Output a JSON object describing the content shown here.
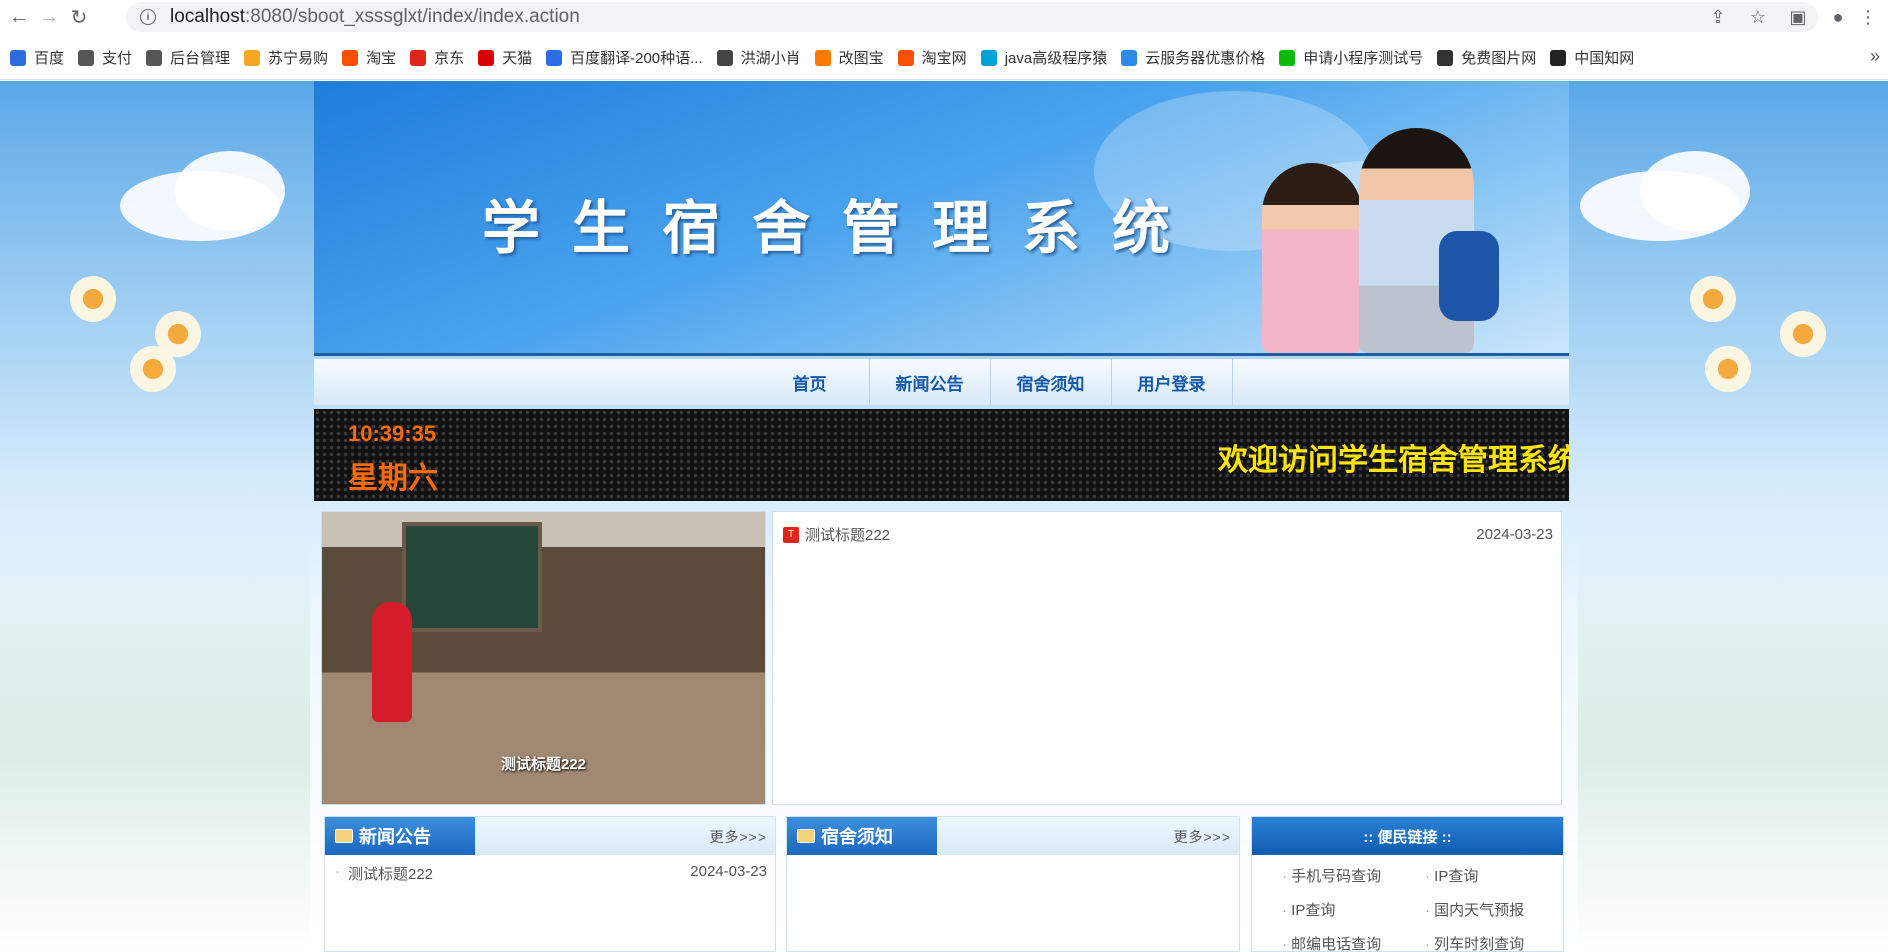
{
  "browser": {
    "url_host": "localhost",
    "url_rest": ":8080/sboot_xsssglxt/index/index.action",
    "bookmarks": [
      {
        "label": "百度",
        "color": "#2d6cdf"
      },
      {
        "label": "支付",
        "color": "#555555"
      },
      {
        "label": "后台管理",
        "color": "#555555"
      },
      {
        "label": "苏宁易购",
        "color": "#f5a623"
      },
      {
        "label": "淘宝",
        "color": "#ff5000"
      },
      {
        "label": "京东",
        "color": "#e1251b"
      },
      {
        "label": "天猫",
        "color": "#d90000"
      },
      {
        "label": "百度翻译-200种语...",
        "color": "#2b6de5"
      },
      {
        "label": "洪湖小肖",
        "color": "#444444"
      },
      {
        "label": "改图宝",
        "color": "#ff7a00"
      },
      {
        "label": "淘宝网",
        "color": "#ff5000"
      },
      {
        "label": "java高级程序猿",
        "color": "#00a1d6"
      },
      {
        "label": "云服务器优惠价格",
        "color": "#2e8ae6"
      },
      {
        "label": "申请小程序测试号",
        "color": "#09bb07"
      },
      {
        "label": "免费图片网",
        "color": "#333333"
      },
      {
        "label": "中国知网",
        "color": "#222222"
      }
    ],
    "bookmarks_more": "»"
  },
  "site": {
    "banner_title": "学生宿舍管理系统",
    "nav": [
      {
        "label": "首页"
      },
      {
        "label": "新闻公告"
      },
      {
        "label": "宿舍须知"
      },
      {
        "label": "用户登录"
      }
    ],
    "clock_time": "10:39:35",
    "clock_day": "星期六",
    "marquee_text": "欢迎访问学生宿舍管理系统"
  },
  "slider": {
    "caption": "测试标题222"
  },
  "news_list": [
    {
      "badge": "T",
      "title": "测试标题222",
      "date": "2024-03-23"
    }
  ],
  "panels": {
    "news": {
      "title": "新闻公告",
      "more": "更多>>>",
      "items": [
        {
          "title": "测试标题222",
          "date": "2024-03-23"
        }
      ]
    },
    "dorm": {
      "title": "宿舍须知",
      "more": "更多>>>"
    },
    "links": {
      "title": ":: 便民链接 ::",
      "items": [
        "手机号码查询",
        "IP查询",
        "IP查询",
        "国内天气预报",
        "邮编电话查询",
        "列车时刻查询"
      ]
    }
  },
  "icons": {
    "back": "←",
    "forward": "→",
    "reload": "↻",
    "share": "⇪",
    "star": "☆",
    "sidepanel": "▣",
    "profile": "●",
    "menu": "⋮"
  }
}
